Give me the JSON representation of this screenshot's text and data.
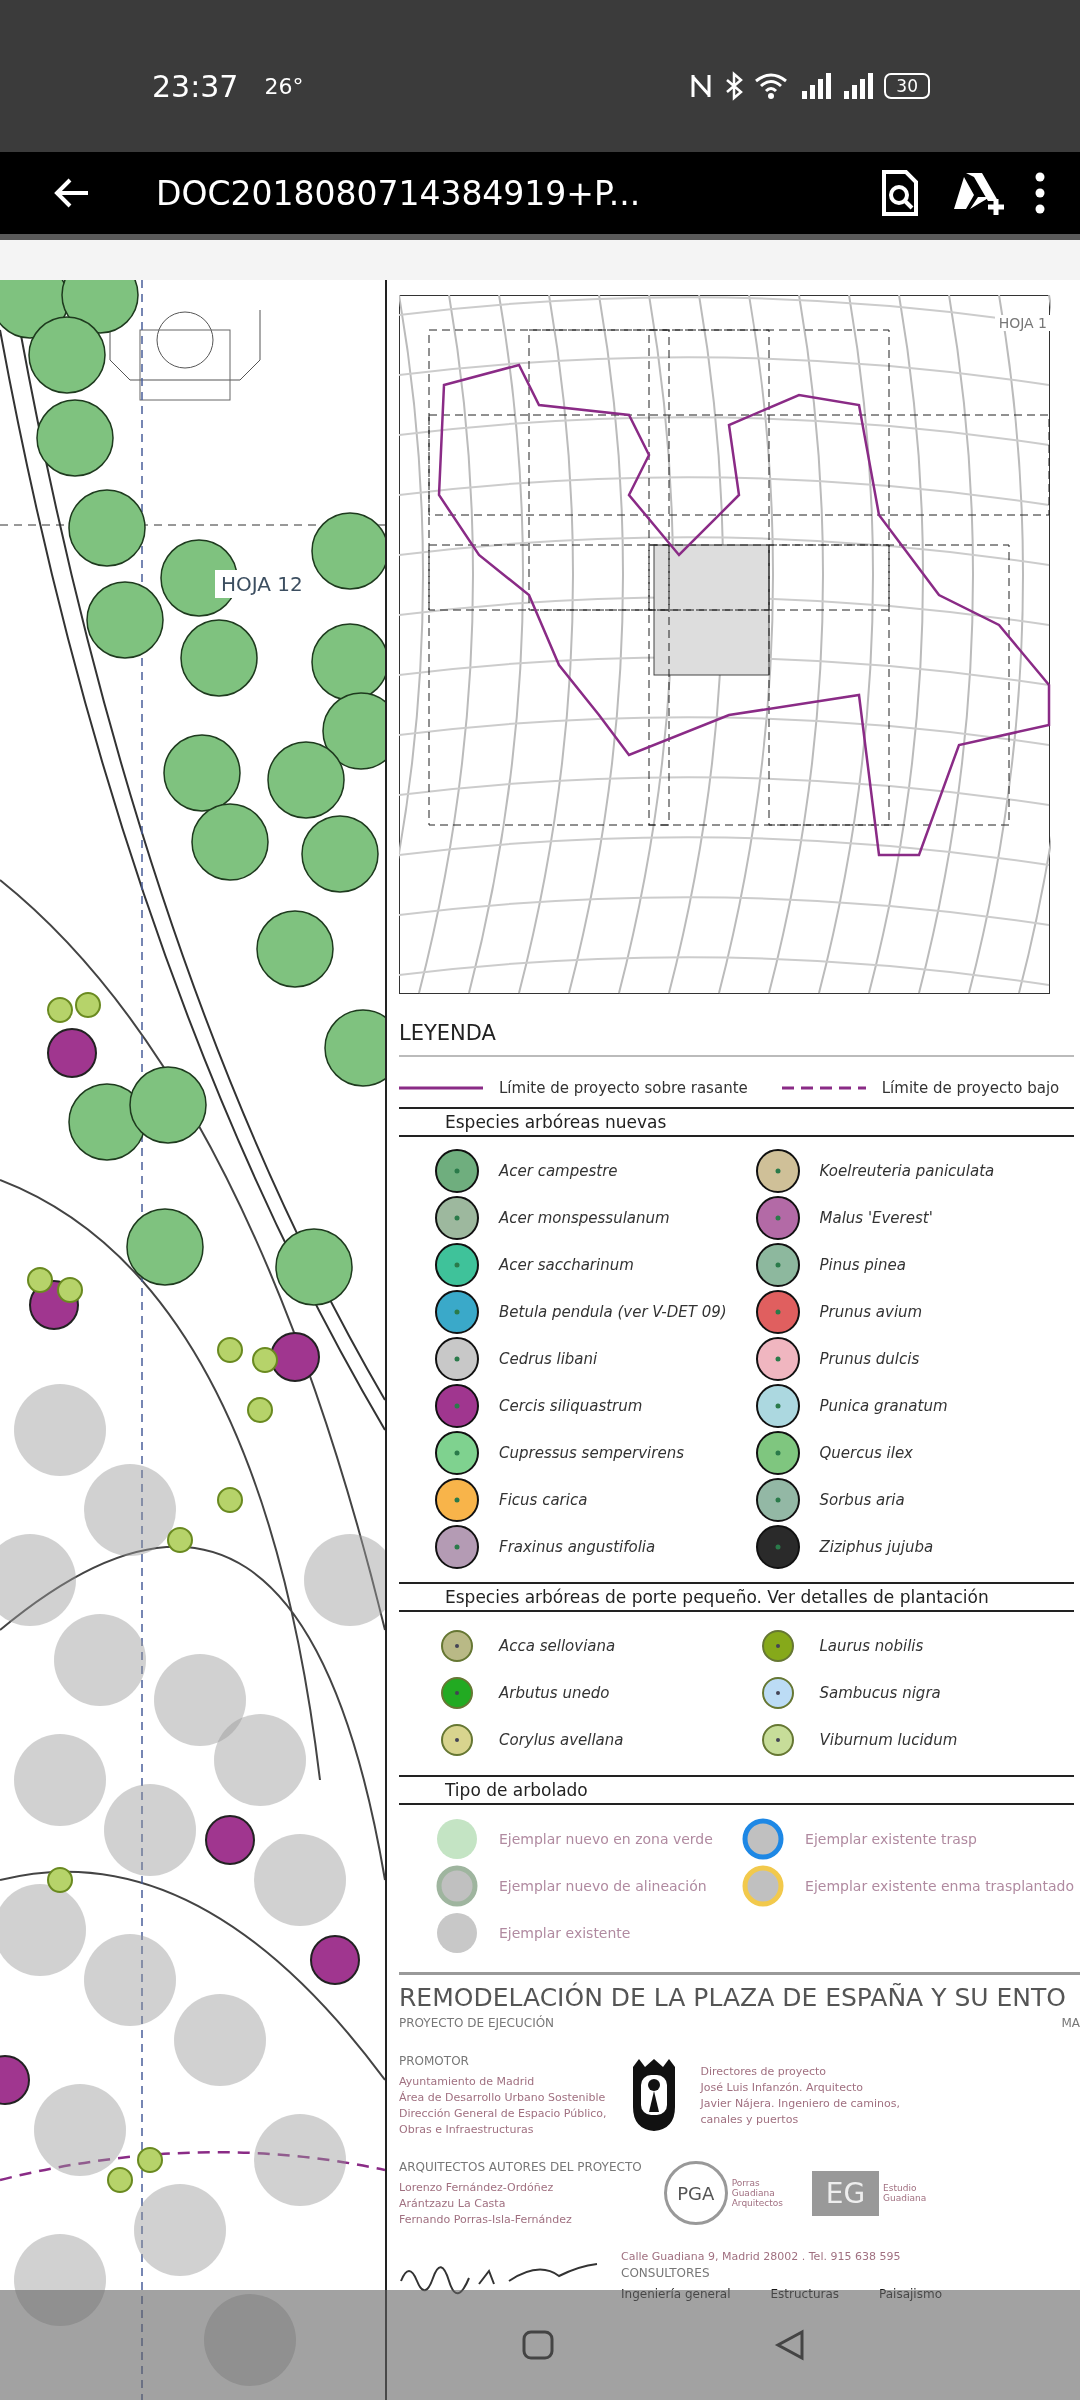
{
  "status_bar": {
    "time": "23:37",
    "temperature": "26°",
    "battery": "30"
  },
  "toolbar": {
    "title": "DOC2018080714384919+P..."
  },
  "document": {
    "plan": {
      "label": "HOJA 12"
    },
    "key_map": {
      "label": "HOJA 1"
    },
    "legend": {
      "title": "LEYENDA",
      "boundaries": [
        {
          "label": "Límite de proyecto sobre rasante",
          "kind": "solid"
        },
        {
          "label": "Límite de proyecto bajo",
          "kind": "dashed"
        }
      ],
      "sections": [
        {
          "title": "Especies arbóreas nuevas",
          "items": [
            {
              "label": "Acer campestre",
              "kind": "tree",
              "color": "#6fae7e"
            },
            {
              "label": "Acer monspessulanum",
              "kind": "tree",
              "color": "#9db89e"
            },
            {
              "label": "Acer saccharinum",
              "kind": "tree",
              "color": "#3fc29a"
            },
            {
              "label": "Betula pendula (ver V-DET 09)",
              "kind": "tree",
              "color": "#3aa9c9"
            },
            {
              "label": "Cedrus libani",
              "kind": "tree",
              "color": "#c8c8c8"
            },
            {
              "label": "Cercis siliquastrum",
              "kind": "tree",
              "color": "#a0368f"
            },
            {
              "label": "Cupressus sempervirens",
              "kind": "tree",
              "color": "#7fd28f"
            },
            {
              "label": "Ficus carica",
              "kind": "tree",
              "color": "#f8b44a"
            },
            {
              "label": "Fraxinus angustifolia",
              "kind": "tree",
              "color": "#b49bb4"
            },
            {
              "label": "Koelreuteria paniculata",
              "kind": "tree",
              "color": "#cfc098"
            },
            {
              "label": "Malus 'Everest'",
              "kind": "tree",
              "color": "#b36aa6"
            },
            {
              "label": "Pinus pinea",
              "kind": "tree",
              "color": "#8db89e"
            },
            {
              "label": "Prunus avium",
              "kind": "tree",
              "color": "#e05f5f"
            },
            {
              "label": "Prunus dulcis",
              "kind": "tree",
              "color": "#f0b6c0"
            },
            {
              "label": "Punica granatum",
              "kind": "tree",
              "color": "#acd8e0"
            },
            {
              "label": "Quercus ilex",
              "kind": "tree",
              "color": "#7fc67f"
            },
            {
              "label": "Sorbus aria",
              "kind": "tree",
              "color": "#93b8a5"
            },
            {
              "label": "Ziziphus jujuba",
              "kind": "tree",
              "color": "#2a2a2a"
            }
          ]
        },
        {
          "title": "Especies arbóreas de porte pequeño. Ver detalles de plantación",
          "items": [
            {
              "label": "Acca selloviana",
              "kind": "dot",
              "color": "#b9b986"
            },
            {
              "label": "Arbutus unedo",
              "kind": "dot",
              "color": "#22aa22"
            },
            {
              "label": "Corylus avellana",
              "kind": "dot",
              "color": "#d8d48e"
            },
            {
              "label": "Laurus nobilis",
              "kind": "dot",
              "color": "#86a91a"
            },
            {
              "label": "Sambucus nigra",
              "kind": "dot",
              "color": "#bcdcf5"
            },
            {
              "label": "Viburnum lucidum",
              "kind": "dot",
              "color": "#c7dd99"
            }
          ]
        },
        {
          "title": "Tipo de arbolado",
          "items": [
            {
              "label": "Ejemplar nuevo en zona verde",
              "kind": "soft",
              "color": "#c4e4c4"
            },
            {
              "label": "Ejemplar nuevo de alineación",
              "kind": "ring",
              "color": "#9fb59f"
            },
            {
              "label": "Ejemplar existente",
              "kind": "soft",
              "color": "#c8c8c8"
            },
            {
              "label": "Ejemplar existente trasp",
              "kind": "ring",
              "color": "#1e88e5"
            },
            {
              "label": "Ejemplar existente enma trasplantado",
              "kind": "ring",
              "color": "#f2c94c"
            }
          ]
        }
      ]
    },
    "title_block": {
      "title": "REMODELACIÓN DE LA PLAZA DE ESPAÑA Y SU ENTO",
      "subtitle": "PROYECTO DE EJECUCIÓN",
      "date": "MA",
      "promoter": {
        "heading": "PROMOTOR",
        "lines": [
          "Ayuntamiento de Madrid",
          "Área de Desarrollo Urbano Sostenible",
          "Dirección General de Espacio Público,",
          "Obras e Infraestructuras"
        ]
      },
      "directors": {
        "lines": [
          "Directores de proyecto",
          "José Luis Infanzón. Arquitecto",
          "Javier Nájera. Ingeniero de caminos,",
          "canales y puertos"
        ]
      },
      "architects": {
        "heading": "ARQUITECTOS AUTORES DEL PROYECTO",
        "lines": [
          "Lorenzo Fernández-Ordóñez",
          "Arántzazu La Casta",
          "Fernando Porras-Isla-Fernández"
        ]
      },
      "firms": [
        {
          "logo": "PGA",
          "name": "Porras Guadiana Arquitectos"
        },
        {
          "logo": "EG",
          "name": "Estudio Guadiana"
        }
      ],
      "address": "Calle Guadiana 9, Madrid 28002 . Tel. 915 638 595",
      "consultants": {
        "heading": "CONSULTORES",
        "items": [
          "Ingeniería general",
          "Estructuras",
          "Paisajismo"
        ]
      }
    }
  }
}
